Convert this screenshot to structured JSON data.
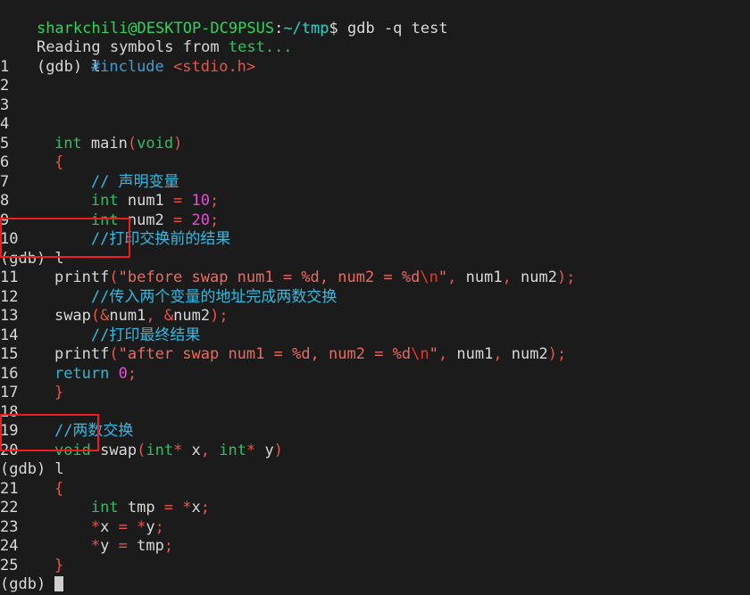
{
  "terminal": {
    "background": "#1b1b1b",
    "foreground": "#d8d8d8",
    "prompt": {
      "user_host": "sharkchili@DESKTOP-DC9PSUS",
      "colon": ":",
      "path": "~/tmp",
      "dollar": "$",
      "command": " gdb -q test"
    },
    "gdb_prompt": "(gdb) ",
    "commands": {
      "list_1": "l",
      "list_2": "l",
      "list_3": "l",
      "final": ""
    },
    "output_lines": {
      "reading_symbols": "Reading symbols from ",
      "reading_target": "test..."
    }
  },
  "code": {
    "file": "test",
    "lines": [
      {
        "n": "1",
        "indent": "        ",
        "tokens": [
          {
            "t": "#include",
            "c": "blue"
          },
          {
            "t": " ",
            "c": "white"
          },
          {
            "t": "<stdio.h>",
            "c": "red"
          }
        ]
      },
      {
        "n": "2",
        "indent": "",
        "tokens": []
      },
      {
        "n": "3",
        "indent": "",
        "tokens": []
      },
      {
        "n": "4",
        "indent": "",
        "tokens": []
      },
      {
        "n": "5",
        "indent": "    ",
        "tokens": [
          {
            "t": "int",
            "c": "green"
          },
          {
            "t": " main",
            "c": "white"
          },
          {
            "t": "(",
            "c": "punct"
          },
          {
            "t": "void",
            "c": "green"
          },
          {
            "t": ")",
            "c": "punct"
          }
        ]
      },
      {
        "n": "6",
        "indent": "    ",
        "tokens": [
          {
            "t": "{",
            "c": "punct"
          }
        ]
      },
      {
        "n": "7",
        "indent": "        ",
        "tokens": [
          {
            "t": "// 声明变量",
            "c": "comment"
          }
        ]
      },
      {
        "n": "8",
        "indent": "        ",
        "tokens": [
          {
            "t": "int",
            "c": "green"
          },
          {
            "t": " num1 ",
            "c": "white"
          },
          {
            "t": "=",
            "c": "punct"
          },
          {
            "t": " ",
            "c": "white"
          },
          {
            "t": "10",
            "c": "magenta"
          },
          {
            "t": ";",
            "c": "punct"
          }
        ]
      },
      {
        "n": "9",
        "indent": "        ",
        "tokens": [
          {
            "t": "int",
            "c": "green"
          },
          {
            "t": " num2 ",
            "c": "white"
          },
          {
            "t": "=",
            "c": "punct"
          },
          {
            "t": " ",
            "c": "white"
          },
          {
            "t": "20",
            "c": "magenta"
          },
          {
            "t": ";",
            "c": "punct"
          }
        ]
      },
      {
        "n": "10",
        "indent": "        ",
        "tokens": [
          {
            "t": "//打印交换前的结果",
            "c": "comment"
          }
        ]
      },
      {
        "n": "11",
        "indent": "    ",
        "tokens": [
          {
            "t": "printf",
            "c": "white"
          },
          {
            "t": "(",
            "c": "punct"
          },
          {
            "t": "\"before swap num1 = %d, num2 = %d",
            "c": "str"
          },
          {
            "t": "\\n",
            "c": "esc"
          },
          {
            "t": "\"",
            "c": "str"
          },
          {
            "t": ",",
            "c": "punct"
          },
          {
            "t": " num1",
            "c": "white"
          },
          {
            "t": ",",
            "c": "punct"
          },
          {
            "t": " num2",
            "c": "white"
          },
          {
            "t": ")",
            "c": "punct"
          },
          {
            "t": ";",
            "c": "punct"
          }
        ]
      },
      {
        "n": "12",
        "indent": "        ",
        "tokens": [
          {
            "t": "//传入两个变量的地址完成两数交换",
            "c": "comment"
          }
        ]
      },
      {
        "n": "13",
        "indent": "    ",
        "tokens": [
          {
            "t": "swap",
            "c": "white"
          },
          {
            "t": "(",
            "c": "punct"
          },
          {
            "t": "&",
            "c": "punct"
          },
          {
            "t": "num1",
            "c": "white"
          },
          {
            "t": ",",
            "c": "punct"
          },
          {
            "t": " ",
            "c": "white"
          },
          {
            "t": "&",
            "c": "punct"
          },
          {
            "t": "num2",
            "c": "white"
          },
          {
            "t": ")",
            "c": "punct"
          },
          {
            "t": ";",
            "c": "punct"
          }
        ]
      },
      {
        "n": "14",
        "indent": "        ",
        "tokens": [
          {
            "t": "//打印最终结果",
            "c": "comment"
          }
        ]
      },
      {
        "n": "15",
        "indent": "    ",
        "tokens": [
          {
            "t": "printf",
            "c": "white"
          },
          {
            "t": "(",
            "c": "punct"
          },
          {
            "t": "\"after swap num1 = %d, num2 = %d",
            "c": "str"
          },
          {
            "t": "\\n",
            "c": "esc"
          },
          {
            "t": "\"",
            "c": "str"
          },
          {
            "t": ",",
            "c": "punct"
          },
          {
            "t": " num1",
            "c": "white"
          },
          {
            "t": ",",
            "c": "punct"
          },
          {
            "t": " num2",
            "c": "white"
          },
          {
            "t": ")",
            "c": "punct"
          },
          {
            "t": ";",
            "c": "punct"
          }
        ]
      },
      {
        "n": "16",
        "indent": "    ",
        "tokens": [
          {
            "t": "return",
            "c": "cyan"
          },
          {
            "t": " ",
            "c": "white"
          },
          {
            "t": "0",
            "c": "magenta"
          },
          {
            "t": ";",
            "c": "punct"
          }
        ]
      },
      {
        "n": "17",
        "indent": "    ",
        "tokens": [
          {
            "t": "}",
            "c": "punct"
          }
        ]
      },
      {
        "n": "18",
        "indent": "",
        "tokens": []
      },
      {
        "n": "19",
        "indent": "    ",
        "tokens": [
          {
            "t": "//两数交换",
            "c": "comment"
          }
        ]
      },
      {
        "n": "20",
        "indent": "    ",
        "tokens": [
          {
            "t": "void",
            "c": "green"
          },
          {
            "t": " swap",
            "c": "white"
          },
          {
            "t": "(",
            "c": "punct"
          },
          {
            "t": "int",
            "c": "green"
          },
          {
            "t": "*",
            "c": "punct"
          },
          {
            "t": " x",
            "c": "white"
          },
          {
            "t": ",",
            "c": "punct"
          },
          {
            "t": " ",
            "c": "white"
          },
          {
            "t": "int",
            "c": "green"
          },
          {
            "t": "*",
            "c": "punct"
          },
          {
            "t": " y",
            "c": "white"
          },
          {
            "t": ")",
            "c": "punct"
          }
        ]
      },
      {
        "n": "21",
        "indent": "    ",
        "tokens": [
          {
            "t": "{",
            "c": "punct"
          }
        ]
      },
      {
        "n": "22",
        "indent": "        ",
        "tokens": [
          {
            "t": "int",
            "c": "green"
          },
          {
            "t": " tmp ",
            "c": "white"
          },
          {
            "t": "=",
            "c": "punct"
          },
          {
            "t": " ",
            "c": "white"
          },
          {
            "t": "*",
            "c": "punct"
          },
          {
            "t": "x",
            "c": "white"
          },
          {
            "t": ";",
            "c": "punct"
          }
        ]
      },
      {
        "n": "23",
        "indent": "        ",
        "tokens": [
          {
            "t": "*",
            "c": "punct"
          },
          {
            "t": "x ",
            "c": "white"
          },
          {
            "t": "=",
            "c": "punct"
          },
          {
            "t": " ",
            "c": "white"
          },
          {
            "t": "*",
            "c": "punct"
          },
          {
            "t": "y",
            "c": "white"
          },
          {
            "t": ";",
            "c": "punct"
          }
        ]
      },
      {
        "n": "24",
        "indent": "        ",
        "tokens": [
          {
            "t": "*",
            "c": "punct"
          },
          {
            "t": "y ",
            "c": "white"
          },
          {
            "t": "=",
            "c": "punct"
          },
          {
            "t": " tmp",
            "c": "white"
          },
          {
            "t": ";",
            "c": "punct"
          }
        ]
      },
      {
        "n": "25",
        "indent": "    ",
        "tokens": [
          {
            "t": "}",
            "c": "punct"
          }
        ]
      }
    ]
  },
  "annotations": {
    "color": "#ee1c1c",
    "boxes": [
      {
        "label": "highlight-gdb-list-after-line-10"
      },
      {
        "label": "highlight-gdb-list-after-line-20"
      }
    ]
  }
}
